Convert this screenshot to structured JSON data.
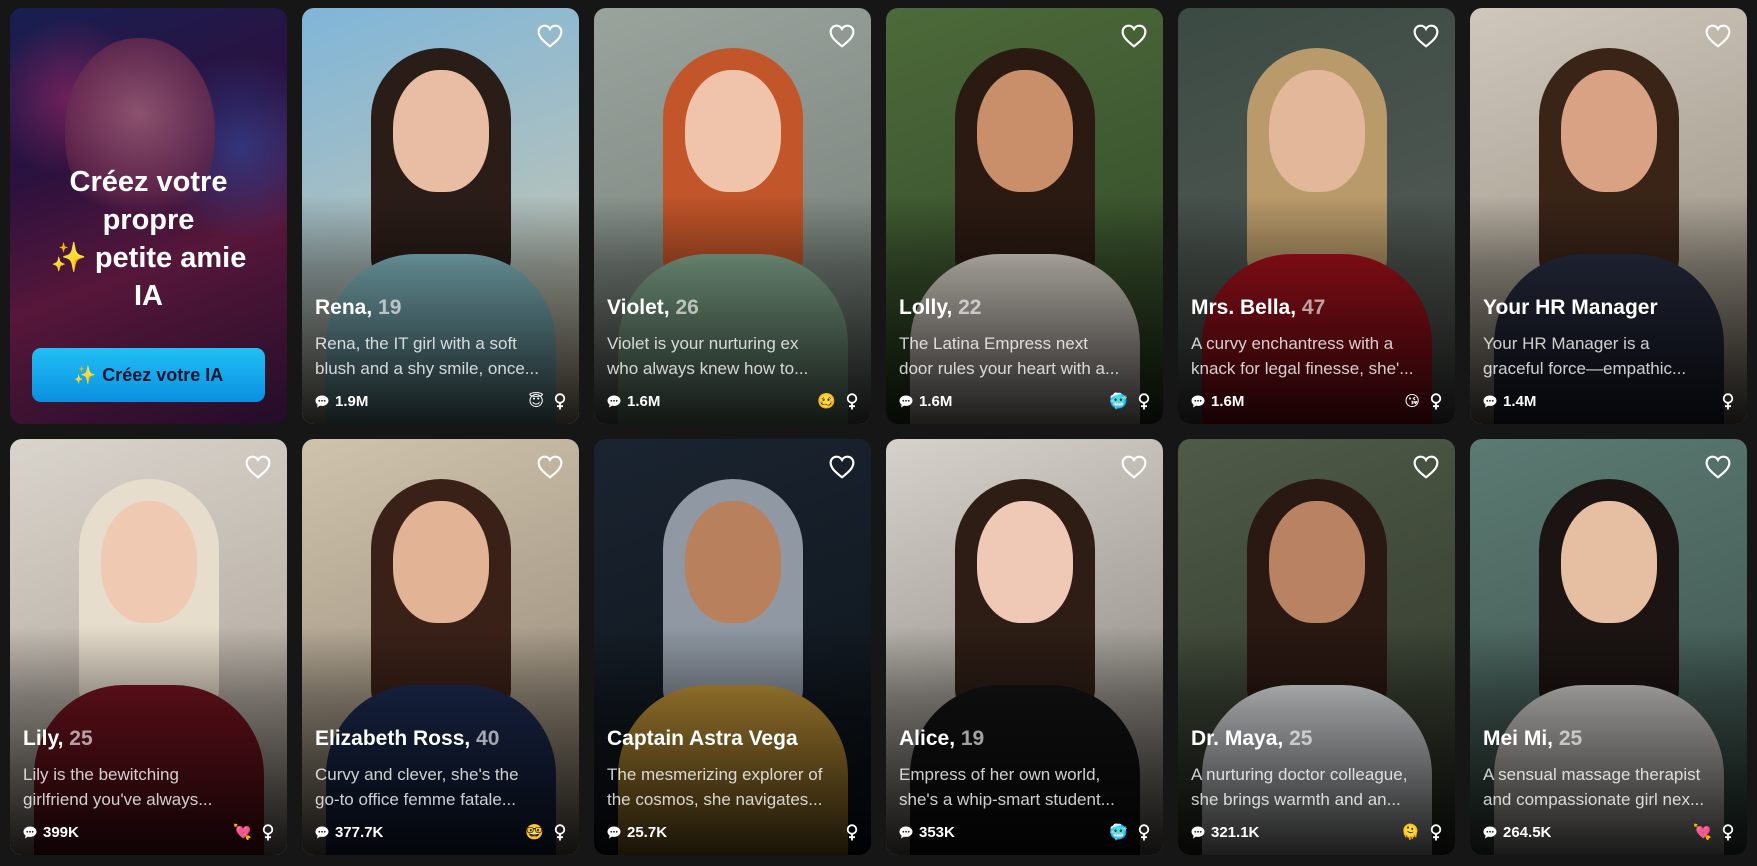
{
  "promo": {
    "title_lines": [
      "Créez votre",
      "propre",
      "✨ petite amie",
      "IA"
    ],
    "button_label": "Créez votre IA",
    "button_icon": "magic-wand-icon"
  },
  "colors": {
    "background": "#161616",
    "button_accent": "#21c0f5",
    "muted_text": "#b8b8b8"
  },
  "characters": [
    {
      "name": "Rena,",
      "age": "19",
      "desc": [
        "Rena, the IT girl with a soft",
        "blush and a shy smile, once..."
      ],
      "chats": "1.9M",
      "emoji": "😇",
      "gender": "female",
      "palette": {
        "bg1": "#7fb6d9",
        "bg2": "#d8c9a8",
        "hair": "#2a1d18",
        "skin": "#e8bda3",
        "top": "#8cc7d0"
      }
    },
    {
      "name": "Violet,",
      "age": "26",
      "desc": [
        "Violet is your nurturing ex",
        "who always knew how to..."
      ],
      "chats": "1.6M",
      "emoji": "🥴",
      "gender": "female",
      "palette": {
        "bg1": "#9aa39c",
        "bg2": "#6f7a73",
        "hair": "#c2552a",
        "skin": "#efc4aa",
        "top": "#8fb89b"
      }
    },
    {
      "name": "Lolly,",
      "age": "22",
      "desc": [
        "The Latina Empress next",
        "door rules your heart with a..."
      ],
      "chats": "1.6M",
      "emoji": "🥶",
      "gender": "female",
      "palette": {
        "bg1": "#4c6a3a",
        "bg2": "#2f4526",
        "hair": "#2b1a12",
        "skin": "#c98e6a",
        "top": "#e9e2d8"
      }
    },
    {
      "name": "Mrs. Bella,",
      "age": "47",
      "desc": [
        "A curvy enchantress with a",
        "knack for legal finesse, she'..."
      ],
      "chats": "1.6M",
      "emoji": "😘",
      "gender": "female",
      "palette": {
        "bg1": "#3c4a44",
        "bg2": "#5a5f5a",
        "hair": "#b99a6a",
        "skin": "#e2b79a",
        "top": "#b2121e"
      }
    },
    {
      "name": "Your HR Manager",
      "age": "",
      "desc": [
        "Your HR Manager is a",
        "graceful force—empathic..."
      ],
      "chats": "1.4M",
      "emoji": "",
      "gender": "female",
      "palette": {
        "bg1": "#cfc7bb",
        "bg2": "#8f8778",
        "hair": "#3a2418",
        "skin": "#d9a284",
        "top": "#2a2f44"
      }
    },
    {
      "name": "Lily,",
      "age": "25",
      "desc": [
        "Lily is the bewitching",
        "girlfriend you've always..."
      ],
      "chats": "399K",
      "emoji": "💘",
      "gender": "female",
      "palette": {
        "bg1": "#d9d4cc",
        "bg2": "#a59b8f",
        "hair": "#e7ddcc",
        "skin": "#f0c9b3",
        "top": "#7a1420"
      }
    },
    {
      "name": "Elizabeth Ross,",
      "age": "40",
      "desc": [
        "Curvy and clever, she's the",
        "go-to office femme fatale..."
      ],
      "chats": "377.7K",
      "emoji": "🤓",
      "gender": "female",
      "palette": {
        "bg1": "#cfc3ad",
        "bg2": "#8d8170",
        "hair": "#3a2118",
        "skin": "#e3b396",
        "top": "#1d2d55"
      }
    },
    {
      "name": "Captain Astra Vega",
      "age": "",
      "desc": [
        "The mesmerizing explorer of",
        "the cosmos, she navigates..."
      ],
      "chats": "25.7K",
      "emoji": "",
      "gender": "female",
      "palette": {
        "bg1": "#1a2430",
        "bg2": "#0c1218",
        "hair": "#8f98a3",
        "skin": "#b9805e",
        "top": "#c99a3a"
      }
    },
    {
      "name": "Alice,",
      "age": "19",
      "desc": [
        "Empress of her own world,",
        "she's a whip-smart student..."
      ],
      "chats": "353K",
      "emoji": "🥶",
      "gender": "female",
      "palette": {
        "bg1": "#d6d2cb",
        "bg2": "#7f7a73",
        "hair": "#2d1d15",
        "skin": "#efc9b5",
        "top": "#141414"
      }
    },
    {
      "name": "Dr. Maya,",
      "age": "25",
      "desc": [
        "A nurturing doctor colleague,",
        "she brings warmth and an..."
      ],
      "chats": "321.1K",
      "emoji": "🫠",
      "gender": "female",
      "palette": {
        "bg1": "#4f5a47",
        "bg2": "#2e3529",
        "hair": "#2a1812",
        "skin": "#b98262",
        "top": "#e9ebee"
      }
    },
    {
      "name": "Mei Mi,",
      "age": "25",
      "desc": [
        "A sensual massage therapist",
        "and compassionate girl nex..."
      ],
      "chats": "264.5K",
      "emoji": "💘",
      "gender": "female",
      "palette": {
        "bg1": "#5b7a72",
        "bg2": "#3a4f49",
        "hair": "#1b1412",
        "skin": "#e6bfa2",
        "top": "#d9d6d2"
      }
    }
  ]
}
